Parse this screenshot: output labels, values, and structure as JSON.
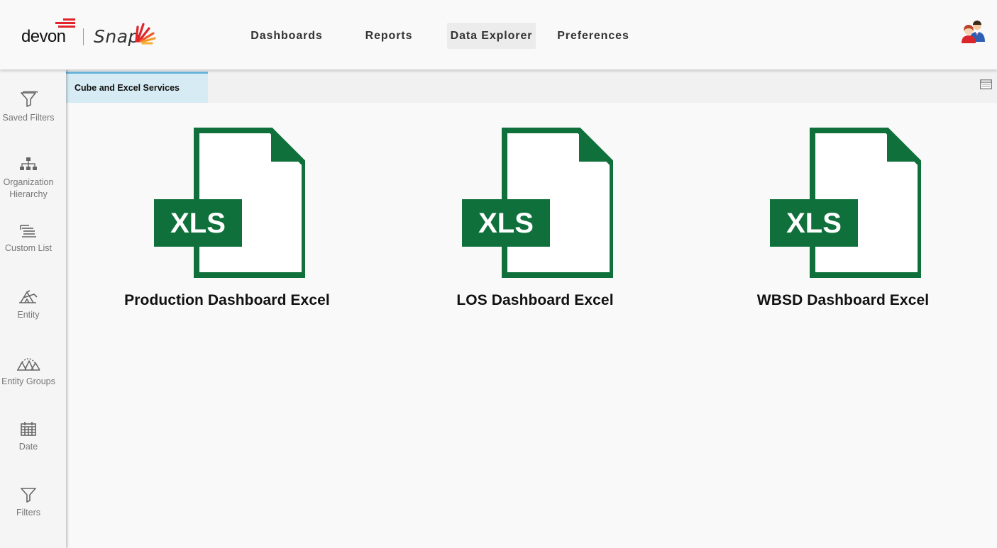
{
  "brand": {
    "company": "devon",
    "product": "Snap"
  },
  "nav": {
    "items": [
      {
        "label": "Dashboards",
        "active": false
      },
      {
        "label": "Reports",
        "active": false
      },
      {
        "label": "Data Explorer",
        "active": true
      },
      {
        "label": "Preferences",
        "active": false
      }
    ]
  },
  "sidebar": {
    "items": [
      {
        "label": "Saved Filters",
        "icon": "saved-filters-icon"
      },
      {
        "label": "Organization Hierarchy",
        "icon": "org-hierarchy-icon"
      },
      {
        "label": "Custom List",
        "icon": "custom-list-icon"
      },
      {
        "label": "Entity",
        "icon": "entity-icon"
      },
      {
        "label": "Entity Groups",
        "icon": "entity-groups-icon"
      },
      {
        "label": "Date",
        "icon": "calendar-icon"
      },
      {
        "label": "Filters",
        "icon": "funnel-icon"
      }
    ]
  },
  "tabs": [
    {
      "label": "Cube and Excel Services",
      "active": true
    }
  ],
  "files": [
    {
      "title": "Production Dashboard Excel",
      "badge": "XLS"
    },
    {
      "title": "LOS Dashboard Excel",
      "badge": "XLS"
    },
    {
      "title": "WBSD Dashboard Excel",
      "badge": "XLS"
    }
  ],
  "colors": {
    "excel_green": "#0f703b",
    "brand_red": "#e0242a",
    "tab_active_bg": "#d6ebf4",
    "tab_active_border": "#6bb7dd"
  }
}
